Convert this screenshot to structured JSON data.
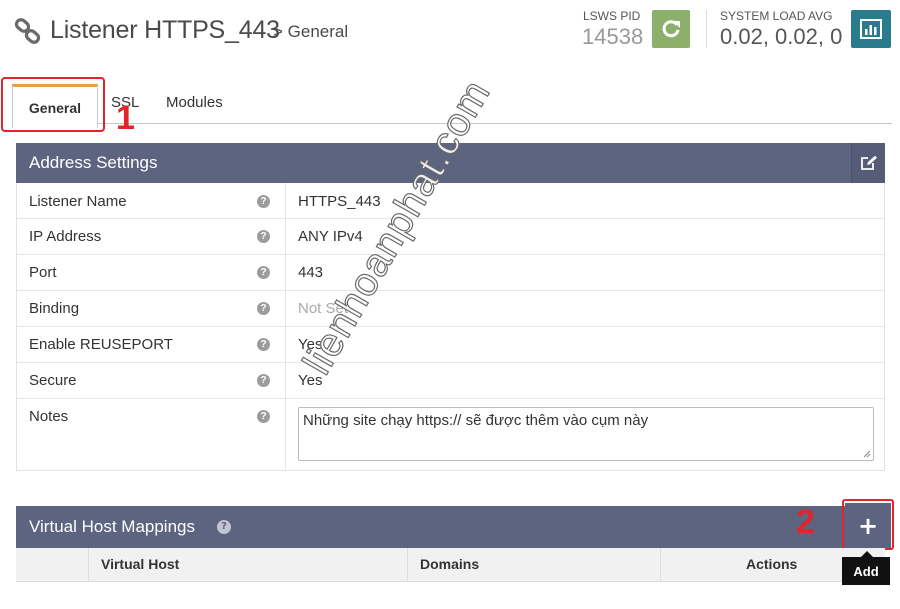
{
  "header": {
    "title": "Listener HTTPS_443",
    "breadcrumb_current": "> General",
    "pid_label": "LSWS PID",
    "pid_value": "14538",
    "load_label": "SYSTEM LOAD AVG",
    "load_value": "0.02, 0.02, 0",
    "icons": [
      "link-icon",
      "restart-icon",
      "chart-icon"
    ]
  },
  "tabs": [
    {
      "label": "General",
      "active": true
    },
    {
      "label": "SSL",
      "active": false
    },
    {
      "label": "Modules",
      "active": false
    }
  ],
  "markers": {
    "one": "1",
    "two": "2"
  },
  "address_settings": {
    "title": "Address Settings",
    "rows": [
      {
        "label": "Listener Name",
        "value": "HTTPS_443"
      },
      {
        "label": "IP Address",
        "value": "ANY IPv4"
      },
      {
        "label": "Port",
        "value": "443"
      },
      {
        "label": "Binding",
        "value": "Not Set"
      },
      {
        "label": "Enable REUSEPORT",
        "value": "Yes"
      },
      {
        "label": "Secure",
        "value": "Yes"
      },
      {
        "label": "Notes",
        "value": "Những site chạy https:// sẽ được thêm vào cụm này"
      }
    ],
    "help_glyph": "?"
  },
  "virtual_host_mappings": {
    "title": "Virtual Host Mappings",
    "columns": [
      "Virtual Host",
      "Domains",
      "Actions"
    ],
    "add_label": "+",
    "add_tooltip": "Add"
  },
  "watermark": "lienhoanphat.com",
  "colors": {
    "panel_header": "#5d6480",
    "restart_button": "#8cb06a",
    "chart_button": "#2a7c8c",
    "active_tab_accent": "#e0a34a",
    "annotation_red": "#e0262b"
  }
}
